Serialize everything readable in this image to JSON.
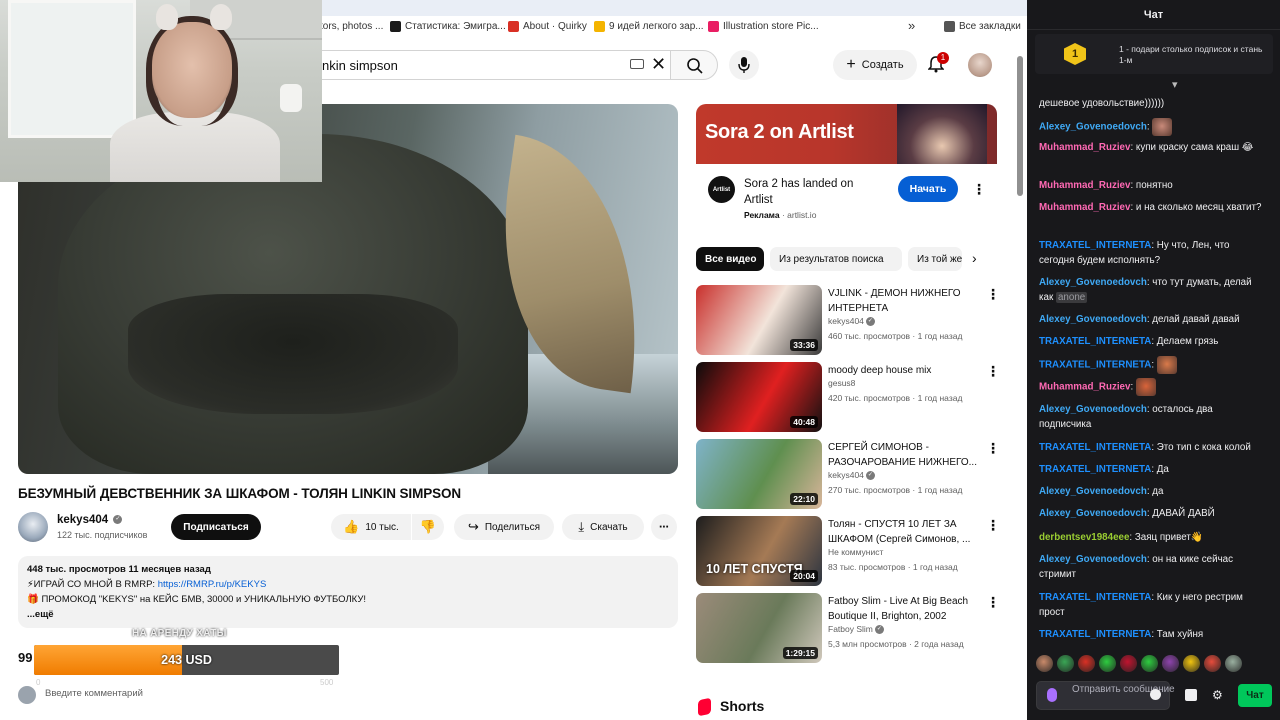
{
  "browser": {
    "bookmarks": [
      {
        "label": "tors, photos ...",
        "color": "#6a6a6a"
      },
      {
        "label": "Статистика: Эмигра...",
        "color": "#1a1a1a"
      },
      {
        "label": "About · Quirky",
        "color": "#d93025"
      },
      {
        "label": "9 идей легкого зар...",
        "color": "#f4b400"
      },
      {
        "label": "Illustration store Pic...",
        "color": "#e91e63"
      },
      {
        "label": "Все закладки",
        "color": "#555555"
      }
    ],
    "more_bookmarks": "»"
  },
  "youtube": {
    "search_query": "nkin simpson",
    "create_label": "Создать",
    "notification_count": "1",
    "video": {
      "title": "БЕЗУМНЫЙ ДЕВСТВЕННИК ЗА ШКАФОМ - ТОЛЯН LINKIN SIMPSON",
      "channel": "kekys404",
      "subscribers": "122 тыс. подписчиков",
      "subscribe_label": "Подписаться",
      "likes": "10 тыс.",
      "share_label": "Поделиться",
      "download_label": "Скачать",
      "description": {
        "stats": "448 тыс. просмотров  11 месяцев назад",
        "line1_prefix": "⚡ИГРАЙ СО МНОЙ В RMRP: ",
        "line1_link": "https://RMRP.ru/p/KEKYS",
        "line2": "🎁 ПРОМОКОД \"KEKYS\" на КЕЙС БМВ, 30000 и УНИКАЛЬНУЮ ФУТБОЛКУ!",
        "more": "...ещё"
      },
      "comments_count_partial": "99",
      "comment_placeholder": "Введите комментарий"
    },
    "donation": {
      "label": "НА АРЕНДУ ХАТЫ",
      "amount": "243 USD",
      "min": "0",
      "max": "500",
      "progress": 0.486
    },
    "ad": {
      "banner_text": "Sora 2 on Artlist",
      "logo_text": "Artlist",
      "title": "Sora 2 has landed on Artlist",
      "label": "Реклама",
      "domain": " · artlist.io",
      "cta": "Начать"
    },
    "chips": [
      {
        "label": "Все видео",
        "active": true
      },
      {
        "label": "Из результатов поиска",
        "active": false
      },
      {
        "label": "Из той же",
        "active": false
      }
    ],
    "recommendations": [
      {
        "title": "VJLINK - ДЕМОН НИЖНЕГО ИНТЕРНЕТА",
        "channel": "kekys404",
        "verified": true,
        "meta": "460 тыс. просмотров  · 1 год назад",
        "duration": "33:36",
        "colors": [
          "#c9302c",
          "#f2e4da",
          "#3a3a3a"
        ]
      },
      {
        "title": "moody deep house mix",
        "channel": "gesus8",
        "verified": false,
        "meta": "420 тыс. просмотров  · 1 год назад",
        "duration": "40:48",
        "colors": [
          "#0b0b0b",
          "#e02020",
          "#111111"
        ]
      },
      {
        "title": "СЕРГЕЙ СИМОНОВ - РАЗОЧАРОВАНИЕ НИЖНЕГО...",
        "channel": "kekys404",
        "verified": true,
        "meta": "270 тыс. просмотров  · 1 год назад",
        "duration": "22:10",
        "colors": [
          "#7fb3c9",
          "#5f8f4f",
          "#d8b59a"
        ]
      },
      {
        "title": "Толян - СПУСТЯ 10 ЛЕТ ЗА ШКАФОМ (Сергей Симонов, ...",
        "channel": "Не коммунист",
        "verified": false,
        "meta": "83 тыс. просмотров  · 1 год назад",
        "duration": "20:04",
        "overlay": "10 ЛЕТ СПУСТЯ",
        "colors": [
          "#1d1d1d",
          "#a57a55",
          "#2c3440"
        ]
      },
      {
        "title": "Fatboy Slim - Live At Big Beach Boutique II, Brighton, 2002",
        "channel": "Fatboy Slim",
        "verified": true,
        "meta": "5,3 млн просмотров  · 2 года назад",
        "duration": "1:29:15",
        "colors": [
          "#9b8b7a",
          "#6a7a5a",
          "#d0c8bc"
        ]
      }
    ],
    "shorts_label": "Shorts"
  },
  "chat": {
    "header": "Чат",
    "gift_number": "1",
    "gift_text": "1 - подари столько подписок и стань 1-м",
    "placeholder": "Отправить сообщение",
    "send_label": "Чат",
    "messages": [
      {
        "user": "",
        "color": "#efeff1",
        "text": "дешевое удовольствие))))))"
      },
      {
        "user": "Alexey_Govenoedovch",
        "color": "#3fa9f5",
        "text": "",
        "emote": "#c98a7a"
      },
      {
        "user": "Muhammad_Ruziev",
        "color": "#ff69b4",
        "text": "купи краску сама краш 😂"
      },
      {
        "user": "Muhammad_Ruziev",
        "color": "#ff69b4",
        "text": "понятно"
      },
      {
        "user": "Muhammad_Ruziev",
        "color": "#ff69b4",
        "text": "и на сколько месяц хватит?"
      },
      {
        "user": "TRAXATEL_INTERNETA",
        "color": "#1e90ff",
        "text": "Ну что, Лен, что сегодня будем исполнять?"
      },
      {
        "user": "Alexey_Govenoedovch",
        "color": "#3fa9f5",
        "text": "что тут думать, делай как ",
        "mention": "anone"
      },
      {
        "user": "Alexey_Govenoedovch",
        "color": "#3fa9f5",
        "text": "делай давай давай"
      },
      {
        "user": "TRAXATEL_INTERNETA",
        "color": "#1e90ff",
        "text": "Делаем грязь"
      },
      {
        "user": "TRAXATEL_INTERNETA",
        "color": "#1e90ff",
        "text": "",
        "emote": "#d97a4a"
      },
      {
        "user": "Muhammad_Ruziev",
        "color": "#ff69b4",
        "text": "",
        "emote": "#d9643a"
      },
      {
        "user": "Alexey_Govenoedovch",
        "color": "#3fa9f5",
        "text": "осталось два подписчика"
      },
      {
        "user": "TRAXATEL_INTERNETA",
        "color": "#1e90ff",
        "text": "Это тип с кока колой"
      },
      {
        "user": "TRAXATEL_INTERNETA",
        "color": "#1e90ff",
        "text": "Да"
      },
      {
        "user": "Alexey_Govenoedovch",
        "color": "#3fa9f5",
        "text": "да"
      },
      {
        "user": "Alexey_Govenoedovch",
        "color": "#3fa9f5",
        "text": "ДАВАЙ ДАВЙ"
      },
      {
        "user": "derbentsev1984eee",
        "color": "#9acd32",
        "text": "Заяц привет👋"
      },
      {
        "user": "Alexey_Govenoedovch",
        "color": "#3fa9f5",
        "text": "он на кике сейчас стримит"
      },
      {
        "user": "TRAXATEL_INTERNETA",
        "color": "#1e90ff",
        "text": "Кик у него рестрим прост"
      },
      {
        "user": "TRAXATEL_INTERNETA",
        "color": "#1e90ff",
        "text": "Там хуйня"
      }
    ],
    "emote_bar": [
      "#c98a6a",
      "#3aa655",
      "#d93025",
      "#2ecc40",
      "#c0142f",
      "#2ecc40",
      "#8e44ad",
      "#f1c40f",
      "#e74c3c",
      "#9ab0a0"
    ]
  }
}
